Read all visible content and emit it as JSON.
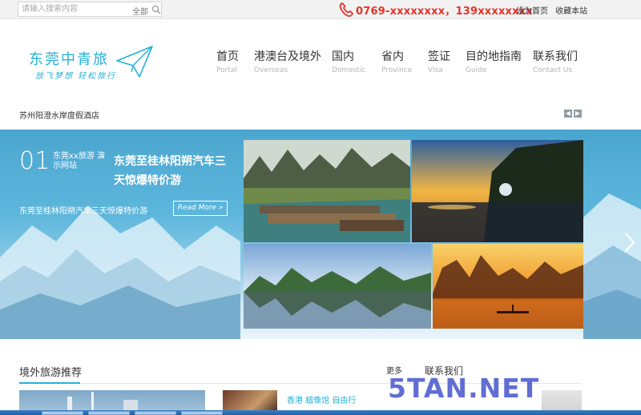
{
  "search": {
    "placeholder": "请输入搜索内容",
    "scope": "全部"
  },
  "top": {
    "phone": "0769-xxxxxxxx，139xxxxxxxx",
    "links": [
      "设为首页",
      "收藏本站"
    ]
  },
  "logo": {
    "title": "东莞中青旅",
    "slogan": "放飞梦想 轻松旅行"
  },
  "nav": [
    {
      "cn": "首页",
      "en": "Portal"
    },
    {
      "cn": "港澳台及境外",
      "en": "Overseas"
    },
    {
      "cn": "国内",
      "en": "Domestic"
    },
    {
      "cn": "省内",
      "en": "Province"
    },
    {
      "cn": "签证",
      "en": "Visa"
    },
    {
      "cn": "目的地指南",
      "en": "Guide"
    },
    {
      "cn": "联系我们",
      "en": "Contact Us"
    }
  ],
  "ticker": {
    "text": "苏州阳澄水岸度假酒店"
  },
  "hero": {
    "number": "01",
    "tag": "东莞xx旅游 演示网站",
    "title": "东莞至桂林阳朔汽车三天惊爆特价游",
    "desc": "东莞至桂林阳朔汽车三天惊爆特价游",
    "read_more": "Read More »"
  },
  "sections": {
    "overseas_title": "境外旅游推荐",
    "more": "更多",
    "contact_title": "联系我们",
    "list_item": "香港 蜡像馆 自由行"
  },
  "watermark": "5TAN.NET",
  "colors": {
    "accent": "#23b1d6",
    "phone": "#e4342a",
    "watermark": "#4f5fcf"
  }
}
